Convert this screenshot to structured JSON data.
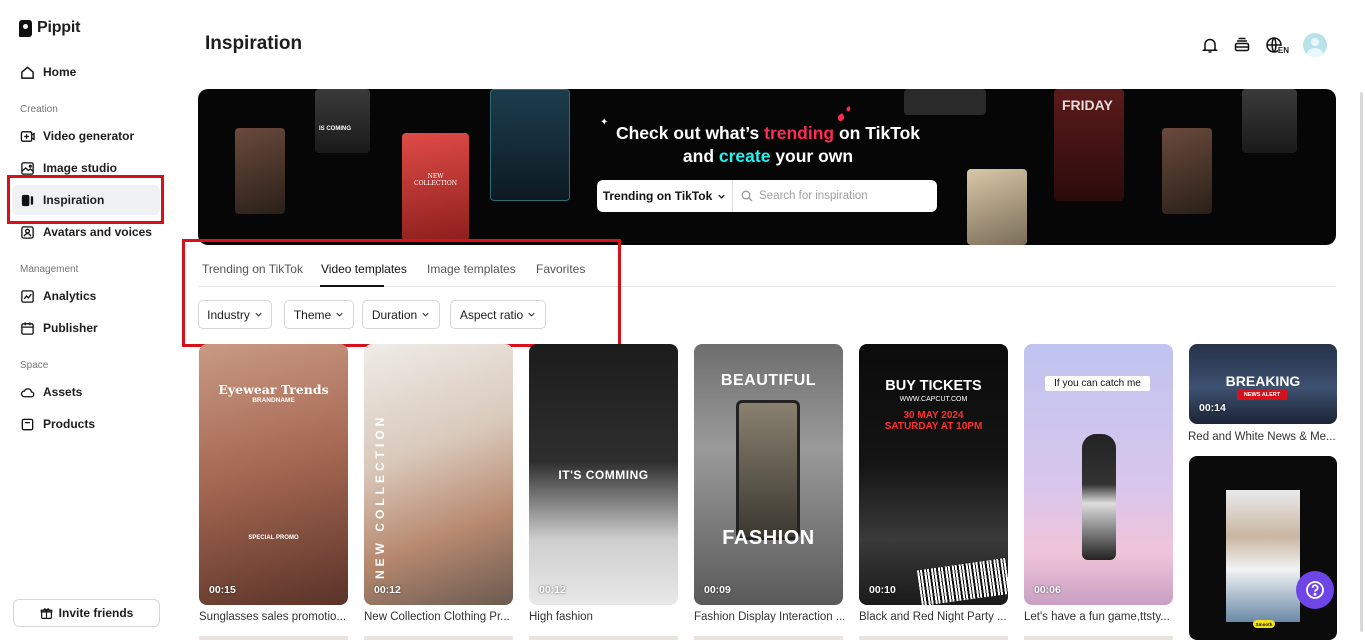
{
  "app": {
    "name": "Pippit"
  },
  "sidebar": {
    "home": "Home",
    "sections": {
      "creation": "Creation",
      "management": "Management",
      "space": "Space"
    },
    "items": [
      {
        "label": "Video generator"
      },
      {
        "label": "Image studio"
      },
      {
        "label": "Inspiration"
      },
      {
        "label": "Avatars and voices"
      },
      {
        "label": "Analytics"
      },
      {
        "label": "Publisher"
      },
      {
        "label": "Assets"
      },
      {
        "label": "Products"
      }
    ],
    "invite": "Invite friends",
    "active_item": "Inspiration"
  },
  "header": {
    "title": "Inspiration",
    "lang": "EN",
    "icons": [
      "bell-icon",
      "stack-icon",
      "globe-icon",
      "avatar"
    ]
  },
  "banner": {
    "line1_a": "Check out what’s ",
    "line1_highlight": "trending",
    "line1_b": " on TikTok",
    "line2_a": "and ",
    "line2_highlight": "create",
    "line2_b": " your own",
    "select_value": "Trending on TikTok",
    "search_placeholder": "Search for inspiration",
    "thumb_texts": {
      "friday": "FRIDAY",
      "coming": "IS COMING",
      "collection": "NEW COLLECTION"
    },
    "colors": {
      "pink": "#fe2c55",
      "cyan": "#25f4ee"
    }
  },
  "tabs": [
    {
      "label": "Trending on TikTok"
    },
    {
      "label": "Video templates"
    },
    {
      "label": "Image templates"
    },
    {
      "label": "Favorites"
    }
  ],
  "active_tab": "Video templates",
  "filters": [
    {
      "label": "Industry"
    },
    {
      "label": "Theme"
    },
    {
      "label": "Duration"
    },
    {
      "label": "Aspect ratio"
    }
  ],
  "cards": [
    {
      "duration": "00:15",
      "caption": "Sunglasses sales promotio...",
      "overlay": "Eyewear Trends",
      "sub": "BRANDNAME",
      "sub2": "SPECIAL PROMO"
    },
    {
      "duration": "00:12",
      "caption": "New Collection Clothing Pr...",
      "overlay": "NEW COLLECTION"
    },
    {
      "duration": "00:12",
      "caption": "High fashion",
      "overlay": "IT'S COMMING"
    },
    {
      "duration": "00:09",
      "caption": "Fashion Display Interaction ...",
      "overlay": "BEAUTIFUL",
      "sub": "FASHION"
    },
    {
      "duration": "00:10",
      "caption": "Black and Red Night Party ...",
      "overlay": "BUY TICKETS",
      "sub": "WWW.CAPCUT.COM",
      "sub2": "30 MAY 2024",
      "sub3": "SATURDAY AT 10PM"
    },
    {
      "duration": "00:06",
      "caption": "Let's have a fun game,ttsty...",
      "overlay": "If you can catch me"
    },
    {
      "duration": "00:14",
      "caption": "Red and White News & Me...",
      "overlay": "BREAKING",
      "sub": "NEWS ALERT"
    },
    {
      "duration": "",
      "caption": "",
      "overlay": "",
      "sub": "Smooth"
    }
  ]
}
